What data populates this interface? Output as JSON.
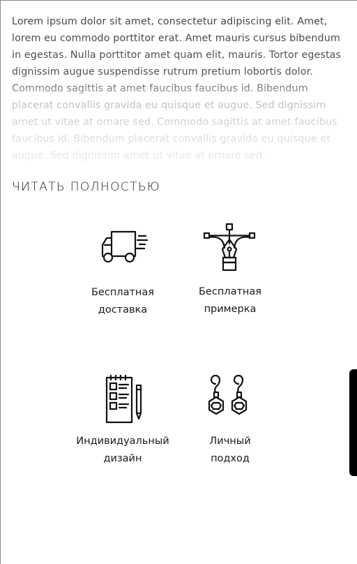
{
  "description": {
    "text": "Lorem ipsum dolor sit amet, consectetur adipiscing elit. Amet, lorem eu commodo porttitor erat. Amet mauris cursus bibendum in egestas. Nulla porttitor amet quam elit, mauris. Tortor egestas dignissim augue suspendisse rutrum pretium lobortis dolor. Commodo sagittis at amet faucibus faucibus id. Bibendum placerat convallis gravida eu quisque et augue. Sed dignissim amet ut vitae at ornare sed. Commodo sagittis at amet faucibus faucibus id. Bibendum placerat convallis gravida eu quisque et augue. Sed dignissim amet ut vitae at ornare sed."
  },
  "read_more_label": "ЧИТАТЬ ПОЛНОСТЬЮ",
  "features": [
    {
      "label": "Бесплатная\nдоставка",
      "icon": "delivery-truck-icon"
    },
    {
      "label": "Бесплатная\nпримерка",
      "icon": "pen-tool-icon"
    },
    {
      "label": "Индивидуальный\nдизайн",
      "icon": "notepad-pencil-icon"
    },
    {
      "label": "Личный\nподход",
      "icon": "earrings-icon"
    }
  ],
  "colors": {
    "text": "#1a1a1a",
    "scrollbar": "#000000"
  }
}
